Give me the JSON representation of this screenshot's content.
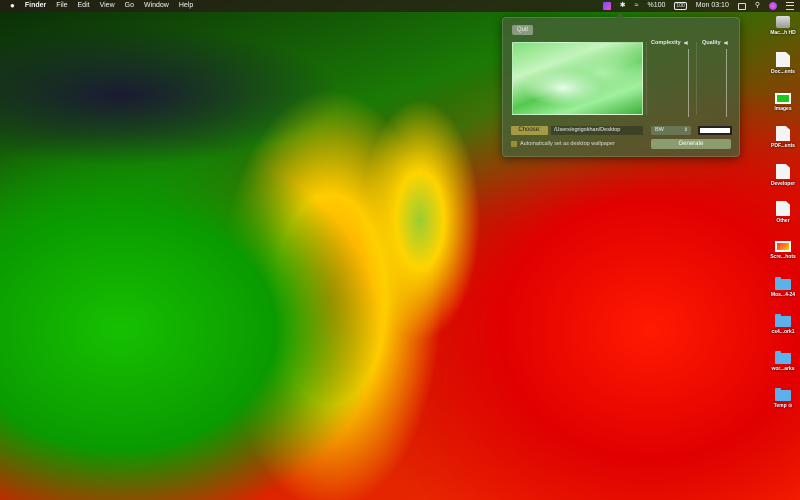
{
  "menubar": {
    "apple": "",
    "app_name": "Finder",
    "menus": [
      "File",
      "Edit",
      "View",
      "Go",
      "Window",
      "Help"
    ],
    "battery_percent": "%100",
    "battery_icon_text": "100",
    "clock": "Mon 03:10"
  },
  "panel": {
    "quit_label": "Quit",
    "complexity_label": "Complexity",
    "quality_label": "Quality",
    "choose_label": "Choose:",
    "path_value": "/Users/egrigokhan/Desktop",
    "mode_select": "BW",
    "auto_wallpaper_label": "Automatically set as desktop wallpaper",
    "generate_label": "Generate",
    "color_well_value": "#ffffff"
  },
  "desktop": {
    "icons": [
      {
        "label": "Mac...h HD",
        "icon": "hard-drive-icon"
      },
      {
        "label": "Doc...ents",
        "icon": "document-icon"
      },
      {
        "label": "Images",
        "icon": "image-icon"
      },
      {
        "label": "PDF...ents",
        "icon": "document-icon"
      },
      {
        "label": "Developer",
        "icon": "document-icon"
      },
      {
        "label": "Other",
        "icon": "document-icon"
      },
      {
        "label": "Scre...hots",
        "icon": "screenshot-icon"
      },
      {
        "label": "Mos...4-24",
        "icon": "folder-icon"
      },
      {
        "label": "cs4...ork1",
        "icon": "folder-icon"
      },
      {
        "label": "wor...arks",
        "icon": "folder-icon"
      },
      {
        "label": "Temp ⊙",
        "icon": "folder-icon"
      }
    ]
  }
}
